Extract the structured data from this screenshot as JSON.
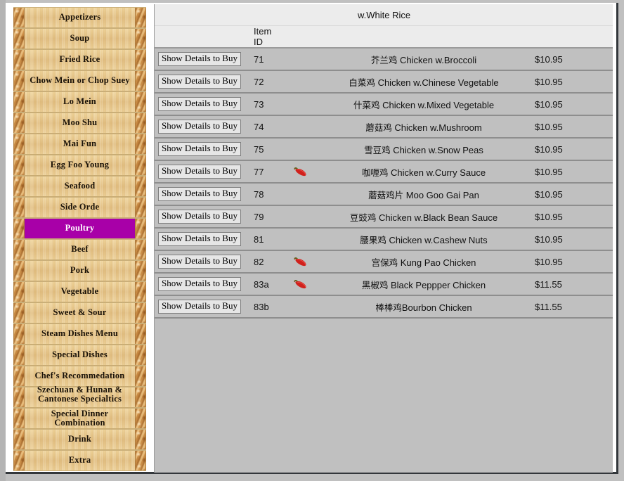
{
  "sidebar": {
    "items": [
      {
        "label": "Appetizers",
        "selected": false
      },
      {
        "label": "Soup",
        "selected": false
      },
      {
        "label": "Fried Rice",
        "selected": false
      },
      {
        "label": "Chow Mein or Chop Suey",
        "selected": false
      },
      {
        "label": "Lo Mein",
        "selected": false
      },
      {
        "label": "Moo Shu",
        "selected": false
      },
      {
        "label": "Mai Fun",
        "selected": false
      },
      {
        "label": "Egg Foo Young",
        "selected": false
      },
      {
        "label": "Seafood",
        "selected": false
      },
      {
        "label": "Side Orde",
        "selected": false
      },
      {
        "label": "Poultry",
        "selected": true
      },
      {
        "label": "Beef",
        "selected": false
      },
      {
        "label": "Pork",
        "selected": false
      },
      {
        "label": "Vegetable",
        "selected": false
      },
      {
        "label": "Sweet & Sour",
        "selected": false
      },
      {
        "label": "Steam Dishes Menu",
        "selected": false
      },
      {
        "label": "Special Dishes",
        "selected": false
      },
      {
        "label": "Chef's Recommedation",
        "selected": false
      },
      {
        "label": "Szechuan & Hunan & Cantonese Specialtics",
        "selected": false,
        "overflow": true
      },
      {
        "label": "Special Dinner Combination",
        "selected": false
      },
      {
        "label": "Drink",
        "selected": false
      },
      {
        "label": "Extra",
        "selected": false
      }
    ]
  },
  "content": {
    "section_title": "w.White Rice",
    "headers": {
      "button": "",
      "item_id": "Item ID",
      "chili": "",
      "name": "",
      "price": ""
    },
    "button_label": "Show Details to Buy",
    "rows": [
      {
        "id": "71",
        "spicy": false,
        "name_cn": "芥兰鸡",
        "name_en": "Chicken w.Broccoli",
        "price": "$10.95"
      },
      {
        "id": "72",
        "spicy": false,
        "name_cn": "白菜鸡",
        "name_en": "Chicken w.Chinese Vegetable",
        "price": "$10.95"
      },
      {
        "id": "73",
        "spicy": false,
        "name_cn": "什菜鸡",
        "name_en": "Chicken w.Mixed Vegetable",
        "price": "$10.95"
      },
      {
        "id": "74",
        "spicy": false,
        "name_cn": "蘑菇鸡",
        "name_en": "Chicken w.Mushroom",
        "price": "$10.95"
      },
      {
        "id": "75",
        "spicy": false,
        "name_cn": "雪豆鸡",
        "name_en": "Chicken w.Snow Peas",
        "price": "$10.95"
      },
      {
        "id": "77",
        "spicy": true,
        "name_cn": "咖喱鸡",
        "name_en": "Chicken w.Curry Sauce",
        "price": "$10.95"
      },
      {
        "id": "78",
        "spicy": false,
        "name_cn": "蘑菇鸡片",
        "name_en": "Moo Goo Gai Pan",
        "price": "$10.95"
      },
      {
        "id": "79",
        "spicy": false,
        "name_cn": "豆豉鸡",
        "name_en": "Chicken w.Black Bean Sauce",
        "price": "$10.95"
      },
      {
        "id": "81",
        "spicy": false,
        "name_cn": "腰果鸡",
        "name_en": "Chicken w.Cashew Nuts",
        "price": "$10.95"
      },
      {
        "id": "82",
        "spicy": true,
        "name_cn": "宫保鸡",
        "name_en": "Kung Pao Chicken",
        "price": "$10.95"
      },
      {
        "id": "83a",
        "spicy": true,
        "name_cn": "黑椒鸡",
        "name_en": "Black Peppper Chicken",
        "price": "$11.55"
      },
      {
        "id": "83b",
        "spicy": false,
        "name_cn": "棒棒鸡",
        "name_en": "Bourbon Chicken",
        "nospace": true,
        "price": "$11.55"
      }
    ]
  },
  "colors": {
    "selected_item_bg": "#a800a8",
    "wood": "#e8c88a",
    "panel_bg": "#c0c0c0",
    "header_bg": "#ececec",
    "chili_red": "#d0211c",
    "chili_stem": "#4a7a22"
  }
}
